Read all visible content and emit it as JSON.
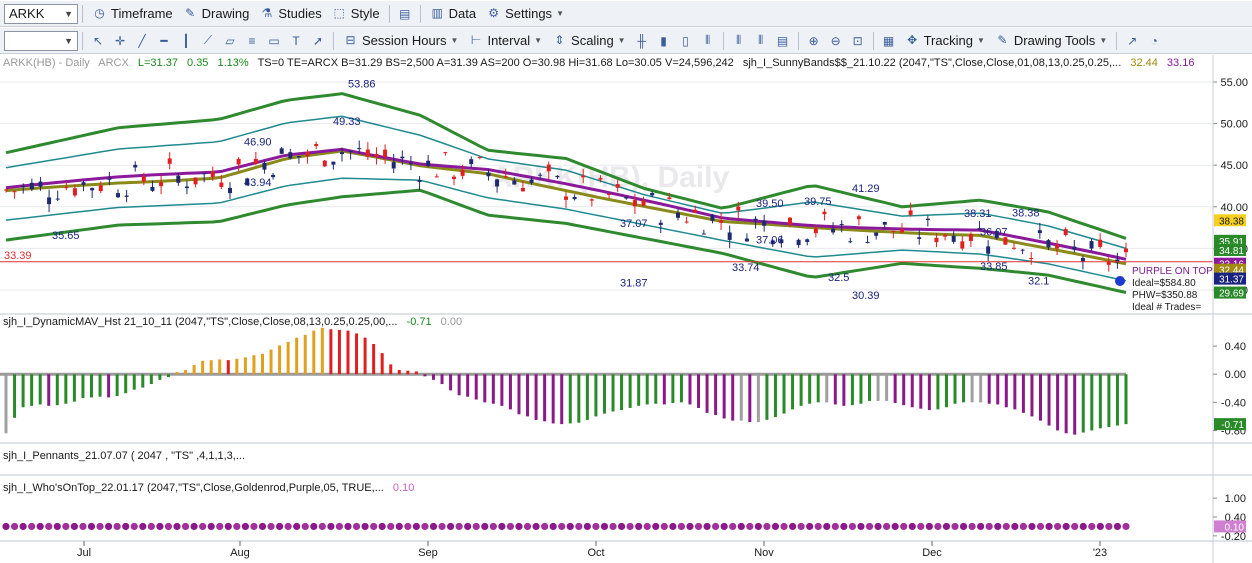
{
  "toolbar1": {
    "symbol": "ARKK",
    "timeframe": "Timeframe",
    "drawing": "Drawing",
    "studies": "Studies",
    "style": "Style",
    "data": "Data",
    "settings": "Settings"
  },
  "toolbar2": {
    "session_hours": "Session Hours",
    "interval": "Interval",
    "scaling": "Scaling",
    "tracking": "Tracking",
    "drawing_tools": "Drawing Tools"
  },
  "header": {
    "symbol": "ARKK(HB) - Daily",
    "exchange": "ARCX",
    "last": "L=31.37",
    "change": "0.35",
    "change_pct": "1.13%",
    "details": "TS=0  TE=ARCX  B=31.29  BS=2,500  A=31.39  AS=200  O=30.98  Hi=31.68  Lo=30.05  V=24,596,242",
    "study": "sjh_I_SunnyBands$$_21.10.22 (2047,\"TS\",Close,Close,01,08,13,0.25,0.25,...",
    "study_v1": "32.44",
    "study_v2": "33.16",
    "watermark": "ARKK(HB), Daily"
  },
  "price_axis": [
    "55.00",
    "50.00",
    "45.00",
    "40.00",
    "35.00",
    "30.00"
  ],
  "price_badges": [
    "38.38",
    "35.91",
    "34.81",
    "33.16",
    "32.44",
    "31.37",
    "29.69"
  ],
  "hline_label": "33.39",
  "annotations": [
    "53.86",
    "46.90",
    "49.33",
    "43.94",
    "35.65",
    "39.50",
    "41.29",
    "39.75",
    "37.06",
    "33.74",
    "32.5",
    "30.39",
    "36.07",
    "38.31",
    "38.38",
    "33.85",
    "32.1",
    "37.07",
    "31.87"
  ],
  "info_box": [
    "PURPLE ON TOP",
    "Ideal=$584.80",
    "PHW=$350.88",
    "Ideal # Trades="
  ],
  "panel2": {
    "title": "sjh_I_DynamicMAV_Hst 21_10_11 (2047,\"TS\",Close,Close,08,13,0.25,0.25,00,...",
    "v1": "-0.71",
    "v2": "0.00",
    "axis": [
      "0.40",
      "0.00",
      "-0.40",
      "-0.80"
    ],
    "badge": "-0.71",
    "hist": [
      -0.84,
      -0.62,
      -0.47,
      -0.45,
      -0.43,
      -0.45,
      -0.44,
      -0.42,
      -0.39,
      -0.34,
      -0.33,
      -0.32,
      -0.33,
      -0.31,
      -0.27,
      -0.22,
      -0.19,
      -0.14,
      -0.08,
      -0.04,
      0.03,
      0.06,
      0.13,
      0.19,
      0.2,
      0.21,
      0.2,
      0.22,
      0.24,
      0.27,
      0.29,
      0.35,
      0.41,
      0.46,
      0.52,
      0.56,
      0.62,
      0.66,
      0.64,
      0.63,
      0.62,
      0.58,
      0.52,
      0.43,
      0.3,
      0.14,
      0.06,
      0.05,
      0.04,
      -0.03,
      -0.08,
      -0.14,
      -0.23,
      -0.3,
      -0.32,
      -0.36,
      -0.4,
      -0.42,
      -0.45,
      -0.5,
      -0.57,
      -0.6,
      -0.65,
      -0.67,
      -0.7,
      -0.71,
      -0.7,
      -0.69,
      -0.65,
      -0.6,
      -0.56,
      -0.53,
      -0.51,
      -0.48,
      -0.45,
      -0.43,
      -0.42,
      -0.43,
      -0.41,
      -0.4,
      -0.43,
      -0.48,
      -0.55,
      -0.58,
      -0.63,
      -0.66,
      -0.66,
      -0.68,
      -0.68,
      -0.65,
      -0.61,
      -0.56,
      -0.5,
      -0.45,
      -0.42,
      -0.4,
      -0.4,
      -0.43,
      -0.45,
      -0.44,
      -0.42,
      -0.38,
      -0.38,
      -0.38,
      -0.41,
      -0.44,
      -0.47,
      -0.49,
      -0.51,
      -0.5,
      -0.47,
      -0.42,
      -0.4,
      -0.4,
      -0.4,
      -0.42,
      -0.43,
      -0.47,
      -0.5,
      -0.55,
      -0.6,
      -0.66,
      -0.73,
      -0.8,
      -0.84,
      -0.86,
      -0.83,
      -0.8,
      -0.77,
      -0.75,
      -0.73,
      -0.71
    ]
  },
  "panel3": {
    "title": "sjh_I_Pennants_21.07.07 ( 2047 , \"TS\" ,4,1,1,3,..."
  },
  "panel4": {
    "title": "sjh_I_Who'sOnTop_22.01.17 (2047,\"TS\",Close,Goldenrod,Purple,05, TRUE,...",
    "value": "0.10",
    "axis": [
      "1.00",
      "0.40",
      "-0.20"
    ],
    "badge": "0.10"
  },
  "time_axis": [
    "Jul",
    "Aug",
    "Sep",
    "Oct",
    "Nov",
    "Dec",
    "'23"
  ],
  "colors": {
    "bull": "#1f2a6e",
    "bear": "#e02020",
    "upper_band": "#2f8a2f",
    "lower_band": "#2f8a2f",
    "inner_band": "#1f8a8f",
    "purple_line": "#8a1a9a",
    "gold_line": "#8a8a1a",
    "hline": "#e03030",
    "hist_green": "#2a8a2a",
    "hist_purple": "#8a1a8a",
    "hist_gold": "#e0a020",
    "hist_red": "#e02020",
    "hist_grey": "#a0a0a0"
  }
}
